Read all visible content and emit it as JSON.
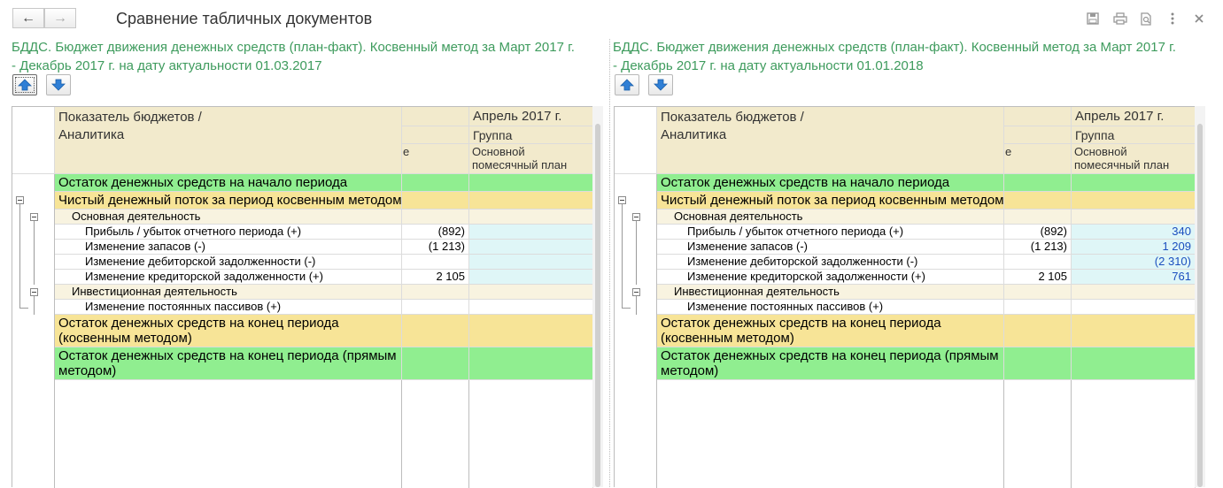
{
  "window": {
    "title": "Сравнение табличных документов",
    "back_icon": "←",
    "forward_icon": "→",
    "header_icons": [
      "save-icon",
      "print-icon",
      "preview-icon",
      "more-icon",
      "close-icon"
    ]
  },
  "left": {
    "doc_title_line1": "БДДС. Бюджет движения денежных средств (план-факт). Косвенный метод  за Март 2017 г.",
    "doc_title_line2": "- Декабрь 2017 г. на дату актуальности 01.03.2017",
    "values": [
      "",
      "",
      "",
      "(892)",
      "(1 213)",
      "",
      "2 105",
      "",
      "",
      "",
      ""
    ],
    "plan_values": [
      "",
      "",
      "",
      "",
      "",
      "",
      "",
      "",
      "",
      "",
      ""
    ]
  },
  "right": {
    "doc_title_line1": "БДДС. Бюджет движения денежных средств (план-факт). Косвенный метод  за Март 2017 г.",
    "doc_title_line2": "- Декабрь 2017 г. на дату актуальности 01.01.2018",
    "values": [
      "",
      "",
      "",
      "(892)",
      "(1 213)",
      "",
      "2 105",
      "",
      "",
      "",
      ""
    ],
    "plan_values": [
      "",
      "",
      "",
      "340",
      "1 209",
      "(2 310)",
      "761",
      "",
      "",
      "",
      ""
    ]
  },
  "table": {
    "header_indicator_line1": "Показатель бюджетов /",
    "header_indicator_line2": "Аналитика",
    "header_period": "Апрель 2017 г.",
    "header_group": "Группа",
    "header_trunc": "е",
    "header_plan_line1": "Основной",
    "header_plan_line2": "помесячный план",
    "rows": [
      {
        "label": "Остаток денежных средств на начало периода"
      },
      {
        "label": "Чистый денежный поток за период косвенным методом"
      },
      {
        "label": "Основная деятельность"
      },
      {
        "label": "Прибыль / убыток отчетного периода (+)"
      },
      {
        "label": "Изменение запасов (-)"
      },
      {
        "label": "Изменение дебиторской задолженности (-)"
      },
      {
        "label": "Изменение кредиторской задолженности (+)"
      },
      {
        "label": "Инвестиционная деятельность"
      },
      {
        "label": "Изменение постоянных пассивов (+)"
      },
      {
        "label": "Остаток денежных средств на конец периода",
        "label2": "(косвенным методом)"
      },
      {
        "label": "Остаток денежных средств на конец периода (прямым",
        "label2": "методом)"
      }
    ]
  },
  "arrows": {
    "up": "up-arrow-icon",
    "down": "down-arrow-icon"
  }
}
